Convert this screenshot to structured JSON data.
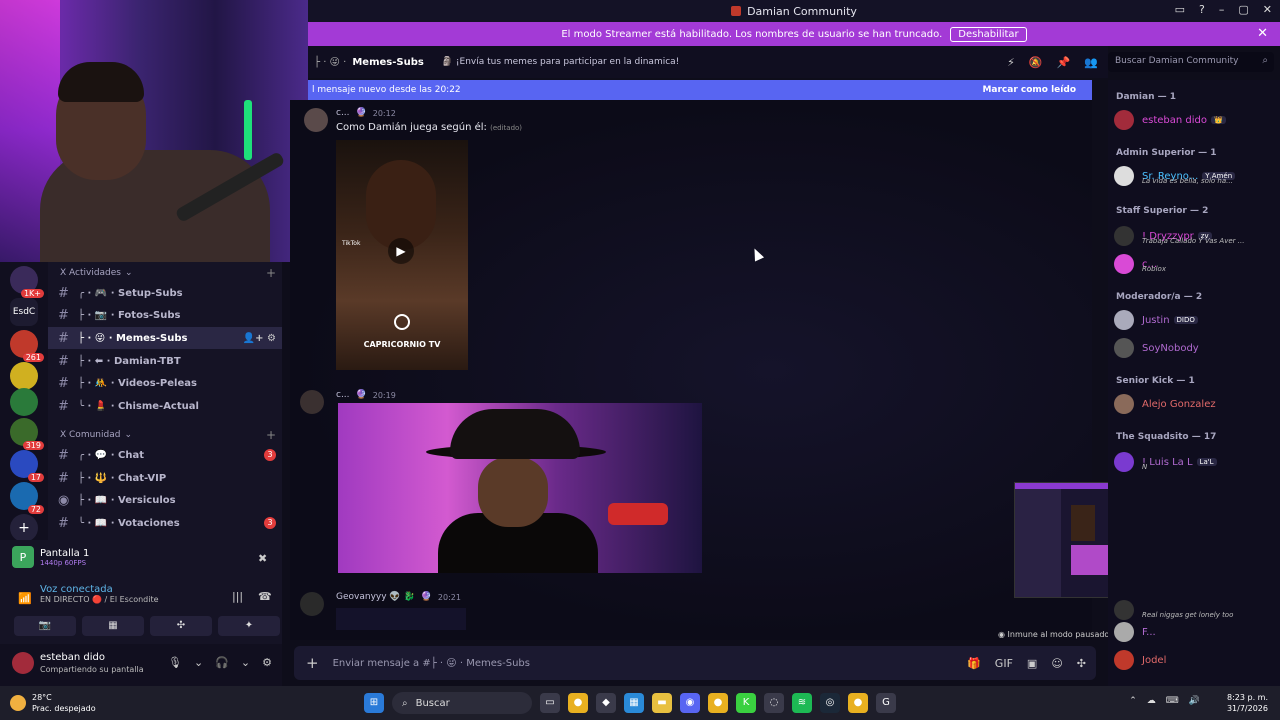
{
  "window": {
    "title": "Damian Community",
    "controls": [
      "▭",
      "?",
      "–",
      "▢",
      "✕"
    ]
  },
  "banner": {
    "text": "El modo Streamer está habilitado. Los nombres de usuario se han truncado.",
    "button": "Deshabilitar",
    "close": "✕"
  },
  "servers": [
    {
      "label": "",
      "badge": "1K+"
    },
    {
      "label": "EsdC",
      "badge": ""
    },
    {
      "label": "",
      "badge": "261"
    },
    {
      "label": "",
      "badge": ""
    },
    {
      "label": "",
      "badge": ""
    },
    {
      "label": "",
      "badge": "319"
    },
    {
      "label": "",
      "badge": "17"
    },
    {
      "label": "",
      "badge": "72"
    },
    {
      "label": "+",
      "badge": ""
    }
  ],
  "categories": [
    {
      "name": "X Actividades",
      "chevron": "⌄"
    },
    {
      "name": "X Comunidad",
      "chevron": "⌄"
    }
  ],
  "channels": [
    {
      "prefix": "╭ · 🎮 ·",
      "name": "Setup-Subs",
      "badge": ""
    },
    {
      "prefix": "├ · 📷 ·",
      "name": "Fotos-Subs",
      "badge": ""
    },
    {
      "prefix": "├ · 😜 ·",
      "name": "Memes-Subs",
      "badge": ""
    },
    {
      "prefix": "├ · ⬅ ·",
      "name": "Damian-TBT",
      "badge": ""
    },
    {
      "prefix": "├ · 🤼 ·",
      "name": "Videos-Peleas",
      "badge": ""
    },
    {
      "prefix": "╰ · 💄 ·",
      "name": "Chisme-Actual",
      "badge": ""
    },
    {
      "prefix": "╭ · 💬 ·",
      "name": "Chat",
      "badge": "3"
    },
    {
      "prefix": "├ · 🔱 ·",
      "name": "Chat-VIP",
      "badge": ""
    },
    {
      "prefix": "├ · 📖 ·",
      "name": "Versiculos",
      "badge": ""
    },
    {
      "prefix": "╰ · 📖 ·",
      "name": "Votaciones",
      "badge": "3"
    }
  ],
  "voice": {
    "screen_title": "Pantalla 1",
    "screen_sub": "1440p 60FPS",
    "connected": "Voz conectada",
    "channel": "EN DIRECTO 🔴 / El Escondite",
    "buttons": [
      "📷",
      "▦",
      "✣",
      "✦"
    ]
  },
  "user": {
    "name": "esteban dido",
    "status": "Compartiendo su pantalla",
    "icons": [
      "🎙",
      "⌄",
      "🎧",
      "⌄",
      "⚙"
    ]
  },
  "chat_header": {
    "channel": "Memes-Subs",
    "prefix": "├ · 😜 ·",
    "topic": "🗿 ¡Envía tus memes para participar en la dinamica!",
    "icons": [
      "⚡",
      "🔕",
      "📌",
      "👥"
    ]
  },
  "search": {
    "placeholder": "Buscar Damian Community"
  },
  "new_messages": {
    "text": "l mensaje nuevo desde las 20:22",
    "action": "Marcar como leído"
  },
  "messages": [
    {
      "author": "c...",
      "time": "20:12",
      "text": "Como Damián juega según él:",
      "edited": "(editado)"
    },
    {
      "author": "c...",
      "time": "20:19",
      "text": "",
      "edited": ""
    },
    {
      "author": "Geovanyyy 👽 🐉",
      "time": "20:21",
      "text": "",
      "edited": ""
    }
  ],
  "video1": {
    "watermark": "TikTok",
    "caption": "CAPRICORNIO TV",
    "play": "▶"
  },
  "paused_note": "Inmune al modo pausado",
  "composer": {
    "placeholder": "Enviar mensaje a #├ · 😜 · Memes-Subs",
    "tools": [
      "🎁",
      "GIF",
      "▣",
      "☺",
      "✣"
    ]
  },
  "members": {
    "roles": [
      {
        "name": "Damian — 1"
      },
      {
        "name": "Admin Superior — 1"
      },
      {
        "name": "Staff Superior — 2"
      },
      {
        "name": "Moderador/a — 2"
      },
      {
        "name": "Senior Kick — 1"
      },
      {
        "name": "The Squadsito — 17"
      }
    ],
    "list": [
      {
        "name": "esteban dido",
        "tag": "👑",
        "sub": "",
        "color": "#d94ad6"
      },
      {
        "name": "Sr. Reyno...",
        "tag": "Y Amén",
        "sub": "La vida es bella, solo ha...",
        "color": "#4ac0ff"
      },
      {
        "name": "! Dryzzypr",
        "tag": "zv",
        "sub": "Trabaja Callado Y Vas Aver ...",
        "color": "#d94ad6"
      },
      {
        "name": "c...",
        "tag": "",
        "sub": "Roblox",
        "color": "#d94ad6"
      },
      {
        "name": "Justin",
        "tag": "DIDO",
        "sub": "",
        "color": "#b06ad0"
      },
      {
        "name": "SoyNobody",
        "tag": "",
        "sub": "",
        "color": "#b06ad0"
      },
      {
        "name": "Alejo Gonzalez",
        "tag": "",
        "sub": "",
        "color": "#e26a6a"
      },
      {
        "name": "! Luis La L",
        "tag": "La'L",
        "sub": "N",
        "color": "#b06ad0"
      },
      {
        "name": "",
        "tag": "",
        "sub": "Real niggas get lonely too",
        "color": "#e26a6a"
      },
      {
        "name": "F...",
        "tag": "",
        "sub": "",
        "color": "#b06ad0"
      },
      {
        "name": "Jodel",
        "tag": "",
        "sub": "",
        "color": "#e26a6a"
      }
    ]
  },
  "taskbar": {
    "weather_temp": "28°C",
    "weather_desc": "Prac. despejado",
    "search": "Buscar",
    "time": "8:23 p. m.",
    "date": "31/7/2026",
    "tray": [
      "⌃",
      "☁",
      "⌨",
      "🔊"
    ]
  },
  "colors": {
    "accent": "#5865f2",
    "banner": "#a33ad6",
    "badge": "#e23c3c"
  }
}
